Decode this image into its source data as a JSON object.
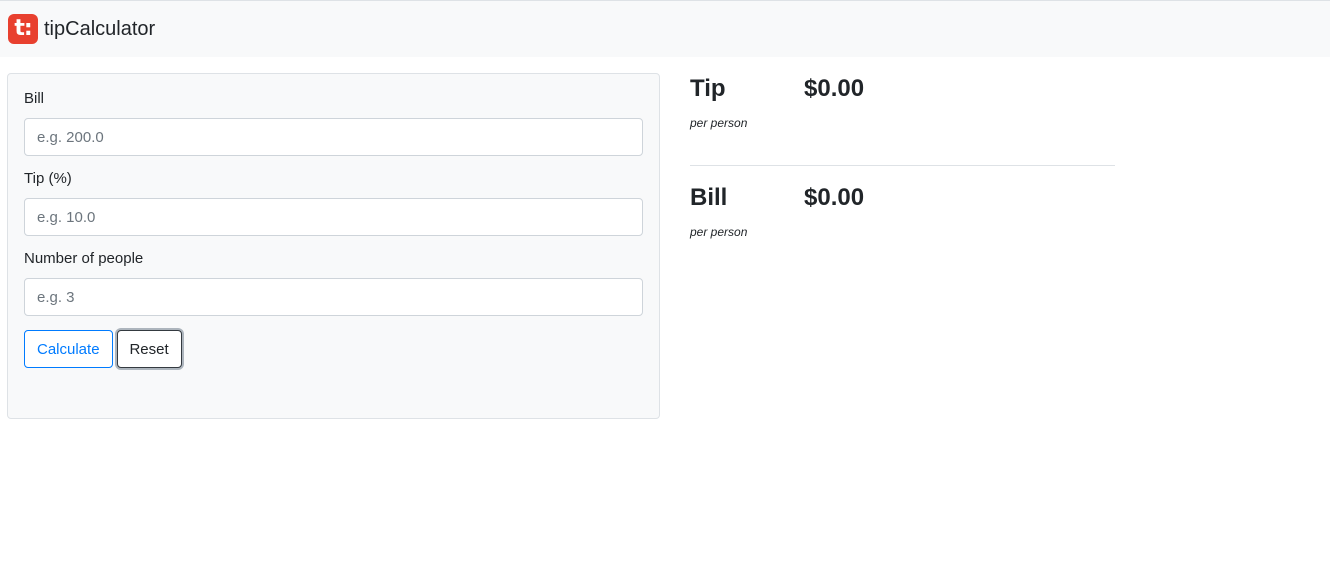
{
  "brand": {
    "logo_text": "t:",
    "name": "tipCalculator"
  },
  "form": {
    "bill": {
      "label": "Bill",
      "placeholder": "e.g. 200.0",
      "value": ""
    },
    "tip": {
      "label": "Tip (%)",
      "placeholder": "e.g. 10.0",
      "value": ""
    },
    "people": {
      "label": "Number of people",
      "placeholder": "e.g. 3",
      "value": ""
    },
    "calculate_label": "Calculate",
    "reset_label": "Reset"
  },
  "results": {
    "tip": {
      "title": "Tip",
      "value": "$0.00",
      "sub": "per person"
    },
    "bill": {
      "title": "Bill",
      "value": "$0.00",
      "sub": "per person"
    }
  },
  "colors": {
    "brand_logo": "#e8402f",
    "primary": "#007bff",
    "navbar_bg": "#f8f9fa"
  },
  "icons": {
    "brand": "tip-calculator-logo-icon"
  }
}
